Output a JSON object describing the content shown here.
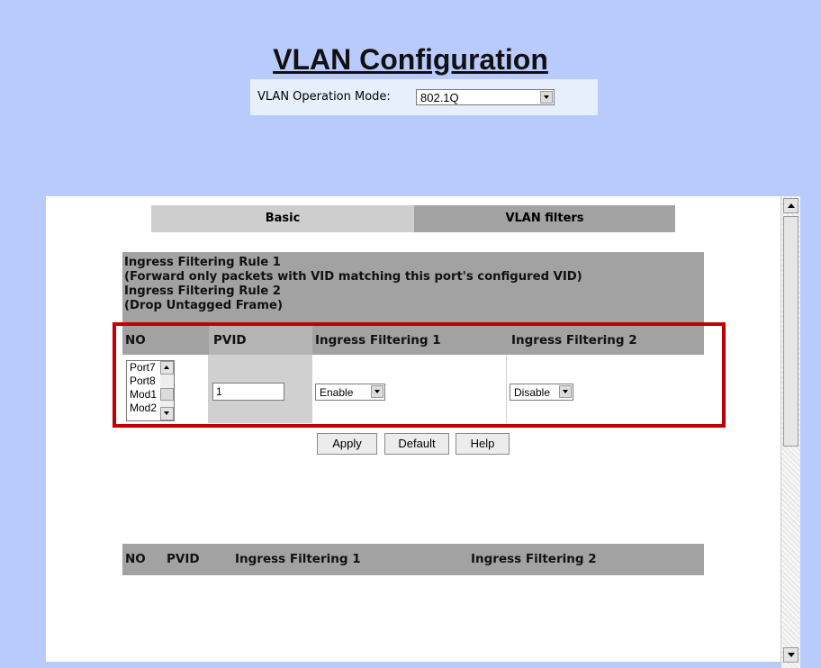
{
  "page": {
    "title": "VLAN Configuration",
    "mode_label": "VLAN Operation Mode:",
    "mode_value": "802.1Q"
  },
  "tabs": [
    {
      "label": "Basic"
    },
    {
      "label": "VLAN filters"
    }
  ],
  "info": {
    "line1": "Ingress Filtering Rule 1",
    "line2": "(Forward only packets with VID matching this port's configured VID)",
    "line3": "Ingress Filtering Rule 2",
    "line4": "(Drop Untagged Frame)"
  },
  "table": {
    "headers": {
      "no": "NO",
      "pvid": "PVID",
      "f1": "Ingress Filtering 1",
      "f2": "Ingress Filtering 2"
    },
    "port_options": [
      "Port7",
      "Port8",
      "Mod1",
      "Mod2"
    ],
    "pvid_value": "1",
    "f1_value": "Enable",
    "f2_value": "Disable"
  },
  "buttons": {
    "apply": "Apply",
    "default": "Default",
    "help": "Help"
  },
  "bottom_table": {
    "headers": {
      "no": "NO",
      "pvid": "PVID",
      "f1": "Ingress Filtering 1",
      "f2": "Ingress Filtering 2"
    }
  },
  "colors": {
    "background": "#b9cbfc",
    "highlight": "#c00000",
    "header_gray": "#a2a2a2"
  }
}
